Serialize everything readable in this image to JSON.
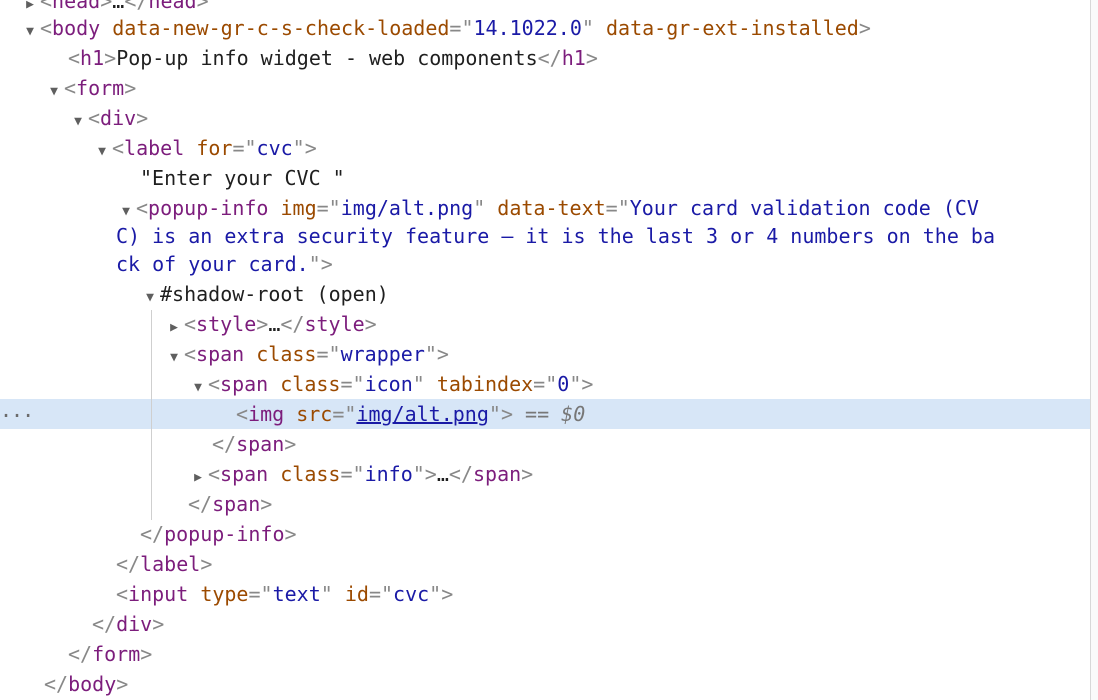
{
  "tree": {
    "head_tag": "head",
    "head_ellipsis": "…",
    "body_tag": "body",
    "body_attr1_name": "data-new-gr-c-s-check-loaded",
    "body_attr1_value": "14.1022.0",
    "body_attr2_name": "data-gr-ext-installed",
    "h1_tag": "h1",
    "h1_text": "Pop-up info widget - web components",
    "form_tag": "form",
    "div_tag": "div",
    "label_tag": "label",
    "label_for_name": "for",
    "label_for_value": "cvc",
    "label_text": "\"Enter your CVC \"",
    "popup_tag": "popup-info",
    "popup_img_name": "img",
    "popup_img_value": "img/alt.png",
    "popup_data_name": "data-text",
    "popup_data_value_line1": "Your card validation code (CV",
    "popup_data_value_line2": "C) is an extra security feature – it is the last 3 or 4 numbers on the ba",
    "popup_data_value_line3": "ck of your card.",
    "shadow_root": "#shadow-root (open)",
    "style_tag": "style",
    "span_tag": "span",
    "class_attr": "class",
    "wrapper_value": "wrapper",
    "icon_value": "icon",
    "tabindex_attr": "tabindex",
    "tabindex_value": "0",
    "img_tag": "img",
    "src_attr": "src",
    "img_src_value": "img/alt.png",
    "selected_marker": "==",
    "selected_ref": "$0",
    "info_value": "info",
    "input_tag": "input",
    "type_attr": "type",
    "type_value": "text",
    "id_attr": "id",
    "id_value": "cvc",
    "row_ellipsis": "..."
  }
}
